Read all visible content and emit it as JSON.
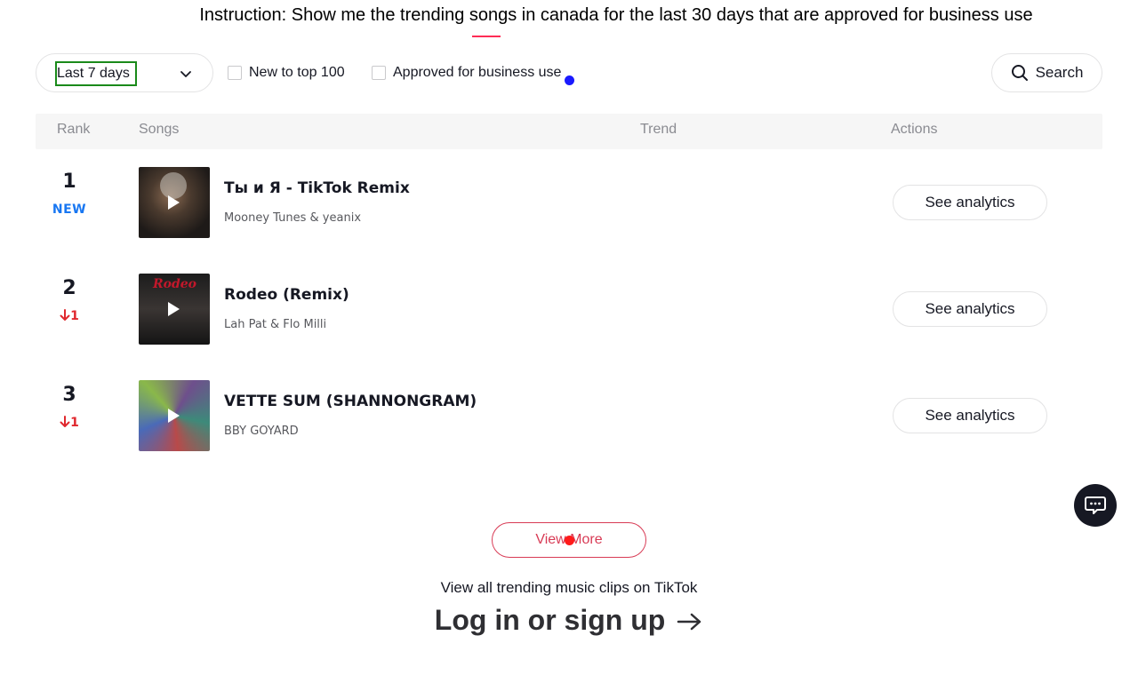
{
  "instruction": "Instruction: Show me the trending songs in canada for the last 30 days that are approved for business use",
  "filters": {
    "period_value": "Last 7 days",
    "new_to_top_100_label": "New to top 100",
    "approved_label": "Approved for business use",
    "search_label": "Search"
  },
  "table": {
    "headers": {
      "rank": "Rank",
      "songs": "Songs",
      "trend": "Trend",
      "actions": "Actions"
    },
    "rows": [
      {
        "rank": "1",
        "change": "NEW",
        "title": "Ты и Я - TikTok Remix",
        "artist": "Mooney Tunes & yeanix",
        "action": "See analytics"
      },
      {
        "rank": "2",
        "change": "1",
        "title": "Rodeo (Remix)",
        "artist": "Lah Pat & Flo Milli",
        "action": "See analytics"
      },
      {
        "rank": "3",
        "change": "1",
        "title": "VETTE SUM (SHANNONGRAM)",
        "artist": "BBY GOYARD",
        "action": "See analytics"
      }
    ]
  },
  "view_more_label": "View More",
  "footer": {
    "text": "View all trending music clips on TikTok",
    "login_label": "Log in or sign up"
  },
  "colors": {
    "accent": "#fe2c55",
    "new_badge": "#1877f2",
    "down_arrow": "#e0282e"
  }
}
